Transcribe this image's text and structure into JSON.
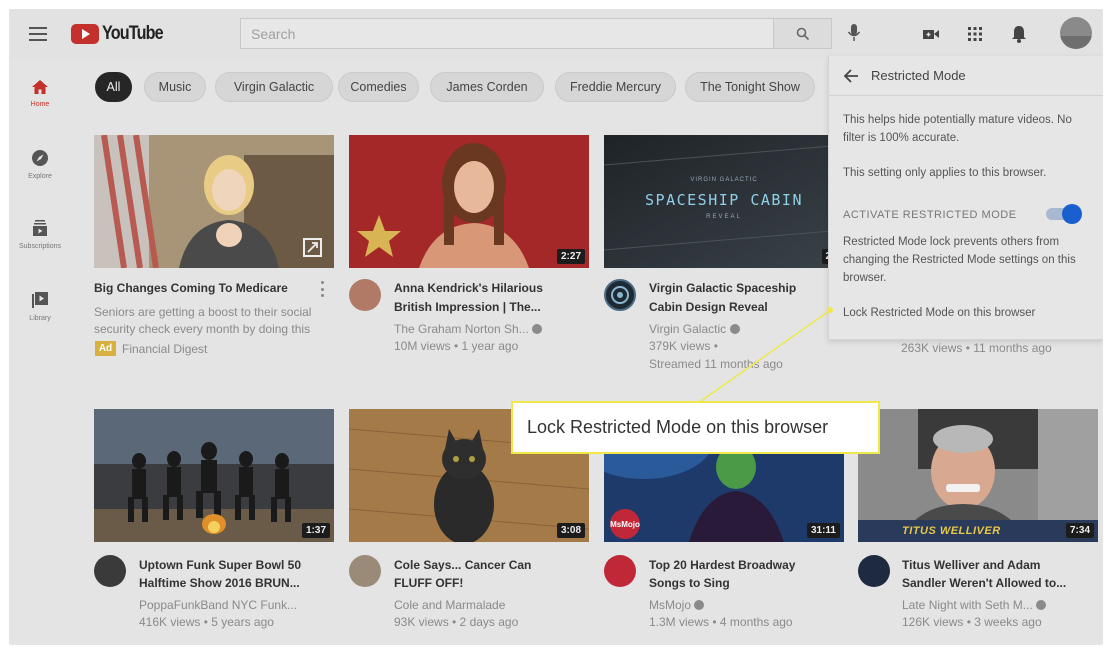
{
  "header": {
    "logo_text": "YouTube",
    "search_placeholder": "Search"
  },
  "sidebar": {
    "items": [
      {
        "label": "Home",
        "icon": "home-icon",
        "active": true
      },
      {
        "label": "Explore",
        "icon": "compass-icon"
      },
      {
        "label": "Subscriptions",
        "icon": "subscriptions-icon"
      },
      {
        "label": "Library",
        "icon": "library-icon"
      }
    ]
  },
  "chips": [
    "All",
    "Music",
    "Virgin Galactic",
    "Comedies",
    "James Corden",
    "Freddie Mercury",
    "The Tonight Show"
  ],
  "videos": [
    {
      "title_1": "Big Changes Coming To Medicare",
      "line_1": "Seniors are getting a boost to their social",
      "line_2": "security check every month by doing this",
      "ad_badge": "Ad",
      "channel": "Financial Digest"
    },
    {
      "title_1": "Anna Kendrick's Hilarious",
      "title_2": "British Impression | The...",
      "channel": "The Graham Norton Sh...",
      "stats": "10M views • 1 year ago",
      "duration": "2:27"
    },
    {
      "title_1": "Virgin Galactic Spaceship",
      "title_2": "Cabin Design Reveal",
      "channel": "Virgin Galactic",
      "stats_1": "379K views •",
      "stats_2": "Streamed 11 months ago",
      "duration": "26:",
      "thumb_text_small": "VIRGIN GALACTIC",
      "thumb_text": "SPACESHIP CABIN",
      "thumb_text_sub": "REVEAL"
    },
    {
      "stats": "263K views • 11 months ago"
    },
    {
      "title_1": "Uptown Funk Super Bowl 50",
      "title_2": "Halftime Show 2016 BRUN...",
      "channel": "PoppaFunkBand NYC Funk...",
      "stats": "416K views • 5 years ago",
      "duration": "1:37"
    },
    {
      "title_1": "Cole Says... Cancer Can",
      "title_2": "FLUFF OFF!",
      "channel": "Cole and Marmalade",
      "stats": "93K views • 2 days ago",
      "duration": "3:08"
    },
    {
      "title_1": "Top 20 Hardest Broadway",
      "title_2": "Songs to Sing",
      "channel": "MsMojo",
      "stats": "1.3M views • 4 months ago",
      "duration": "31:11",
      "thumb_badge": "MsMojo"
    },
    {
      "title_1": "Titus Welliver and Adam",
      "title_2": "Sandler Weren't Allowed to...",
      "channel": "Late Night with Seth M...",
      "stats": "126K views • 3 weeks ago",
      "duration": "7:34",
      "thumb_caption": "TITUS WELLIVER"
    }
  ],
  "panel": {
    "title": "Restricted Mode",
    "desc_1": "This helps hide potentially mature videos. No filter is 100% accurate.",
    "desc_2": "This setting only applies to this browser.",
    "toggle_label": "ACTIVATE RESTRICTED MODE",
    "toggle_on": true,
    "lock_desc": "Restricted Mode lock prevents others from changing the Restricted Mode settings on this browser.",
    "lock_link": "Lock Restricted Mode on this browser"
  },
  "callout": {
    "text": "Lock Restricted Mode on this browser"
  },
  "colors": {
    "brand_red": "#c4302b",
    "toggle_blue": "#1a5fd0",
    "callout_yellow": "#eee84a"
  }
}
